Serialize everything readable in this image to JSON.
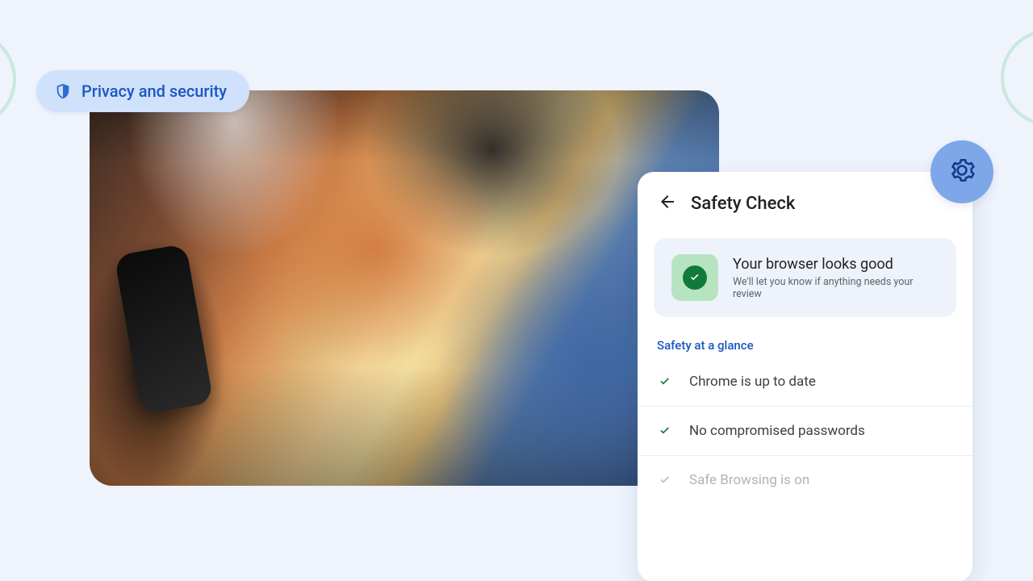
{
  "badge": {
    "label": "Privacy and security"
  },
  "card": {
    "title": "Safety Check",
    "status": {
      "title": "Your browser looks good",
      "subtitle": "We'll let you know if anything needs your review"
    },
    "section_label": "Safety at a glance",
    "items": [
      {
        "label": "Chrome is up to date"
      },
      {
        "label": "No compromised passwords"
      },
      {
        "label": "Safe Browsing is on"
      }
    ]
  }
}
